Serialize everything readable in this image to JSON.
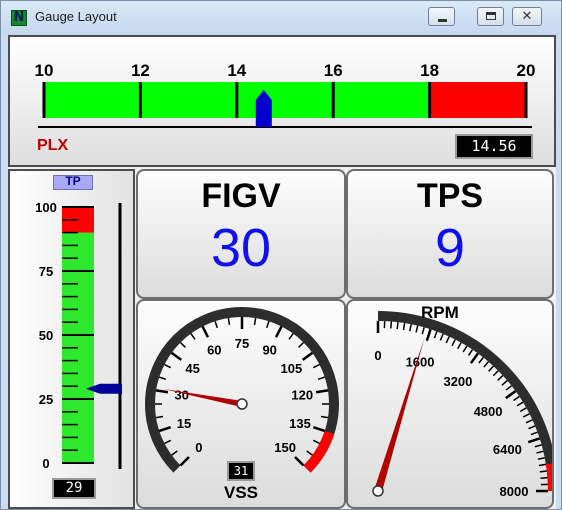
{
  "window": {
    "title": "Gauge Layout"
  },
  "plx": {
    "scale_labels": [
      "10",
      "12",
      "14",
      "16",
      "18",
      "20"
    ],
    "label": "PLX",
    "value": 14.56,
    "readout": "14.56",
    "min": 10,
    "max": 20,
    "redline_start": 18,
    "colors": {
      "normal": "#00ff00",
      "danger": "#ff0000",
      "pointer": "#0000cc",
      "label": "#c00000"
    }
  },
  "tp": {
    "label": "TP",
    "scale_labels": [
      "100",
      "75",
      "50",
      "25",
      "0"
    ],
    "value": 29,
    "readout": "29",
    "redline_start": 90
  },
  "figv": {
    "label": "FIGV",
    "value": "30"
  },
  "tps": {
    "label": "TPS",
    "value": "9"
  },
  "vss": {
    "label": "VSS",
    "scale_labels": [
      "0",
      "15",
      "30",
      "45",
      "60",
      "75",
      "90",
      "105",
      "120",
      "135",
      "150"
    ],
    "value": 31,
    "readout": "31",
    "min": 0,
    "max": 150,
    "redline_start": 135
  },
  "rpm": {
    "label": "RPM",
    "scale_labels": [
      "0",
      "1600",
      "3200",
      "4800",
      "6400",
      "8000"
    ],
    "value": 1500,
    "min": 0,
    "max": 8000,
    "redline_start": 7200
  }
}
